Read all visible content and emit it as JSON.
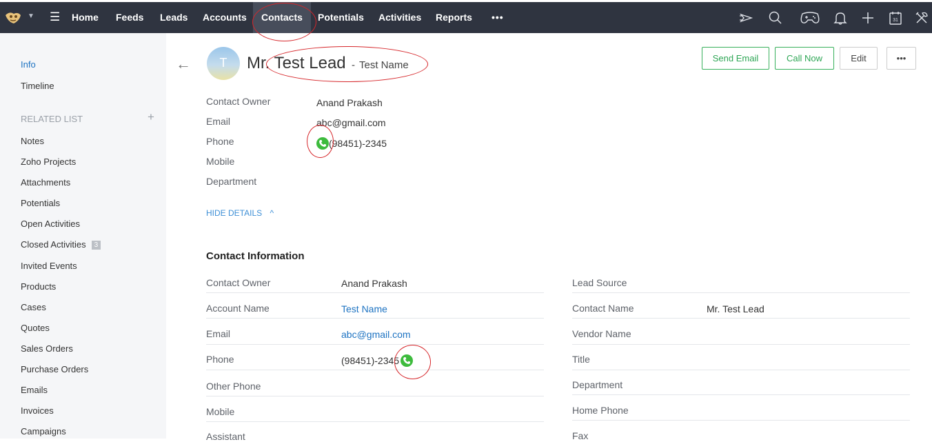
{
  "nav": {
    "tabs": [
      "Home",
      "Feeds",
      "Leads",
      "Accounts",
      "Contacts",
      "Potentials",
      "Activities",
      "Reports"
    ],
    "active_tab": "Contacts",
    "more": "•••"
  },
  "top_icons": [
    "feedback-icon",
    "search-icon",
    "gamepad-icon",
    "bell-icon",
    "plus-icon",
    "calendar-icon",
    "tools-icon"
  ],
  "calendar_day": "31",
  "sidebar": {
    "info": "Info",
    "timeline": "Timeline",
    "related_header": "RELATED LIST",
    "items": [
      "Notes",
      "Zoho Projects",
      "Attachments",
      "Potentials",
      "Open Activities",
      "Closed Activities",
      "Invited Events",
      "Products",
      "Cases",
      "Quotes",
      "Sales Orders",
      "Purchase Orders",
      "Emails",
      "Invoices",
      "Campaigns"
    ],
    "closed_activities_count": "3"
  },
  "record": {
    "avatar_letter": "T",
    "name": "Mr. Test Lead",
    "sep": "-",
    "account": "Test Name"
  },
  "buttons": {
    "send_email": "Send Email",
    "call_now": "Call Now",
    "edit": "Edit",
    "more": "•••"
  },
  "summary": [
    {
      "label": "Contact Owner",
      "value": "Anand Prakash"
    },
    {
      "label": "Email",
      "value": "abc@gmail.com"
    },
    {
      "label": "Phone",
      "value": "(98451)-2345"
    },
    {
      "label": "Mobile",
      "value": ""
    },
    {
      "label": "Department",
      "value": ""
    }
  ],
  "hide_details": "HIDE DETAILS",
  "section_title": "Contact Information",
  "info_left": [
    {
      "label": "Contact Owner",
      "value": "Anand Prakash"
    },
    {
      "label": "Account Name",
      "value": "Test Name"
    },
    {
      "label": "Email",
      "value": "abc@gmail.com"
    },
    {
      "label": "Phone",
      "value": "(98451)-2345"
    },
    {
      "label": "Other Phone",
      "value": ""
    },
    {
      "label": "Mobile",
      "value": ""
    },
    {
      "label": "Assistant",
      "value": ""
    }
  ],
  "info_right": [
    {
      "label": "Lead Source",
      "value": ""
    },
    {
      "label": "Contact Name",
      "value": "Mr. Test Lead"
    },
    {
      "label": "Vendor Name",
      "value": ""
    },
    {
      "label": "Title",
      "value": ""
    },
    {
      "label": "Department",
      "value": ""
    },
    {
      "label": "Home Phone",
      "value": ""
    },
    {
      "label": "Fax",
      "value": ""
    }
  ],
  "colors": {
    "topbar": "#2f3440",
    "accent_green": "#2ea655",
    "link_blue": "#1d73c2",
    "annotation_red": "#d6262a"
  }
}
